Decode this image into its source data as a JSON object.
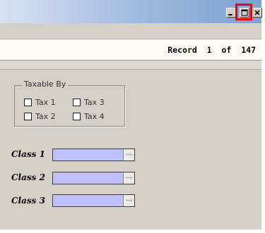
{
  "titlebar": {
    "minimize_glyph": "_",
    "maximize_glyph": "□",
    "close_glyph": "×"
  },
  "record": {
    "label": "Record",
    "current": "1",
    "separator": "of",
    "total": "147"
  },
  "taxable": {
    "legend": "Taxable By",
    "options": [
      {
        "label": "Tax 1",
        "checked": false
      },
      {
        "label": "Tax 3",
        "checked": false
      },
      {
        "label": "Tax 2",
        "checked": false
      },
      {
        "label": "Tax 4",
        "checked": false
      }
    ]
  },
  "classes": [
    {
      "label": "Class 1",
      "value": ""
    },
    {
      "label": "Class 2",
      "value": ""
    },
    {
      "label": "Class 3",
      "value": ""
    }
  ],
  "ellipsis_label": "...",
  "colors": {
    "field_bg": "#c0c0fd",
    "highlight": "#e8000b"
  }
}
